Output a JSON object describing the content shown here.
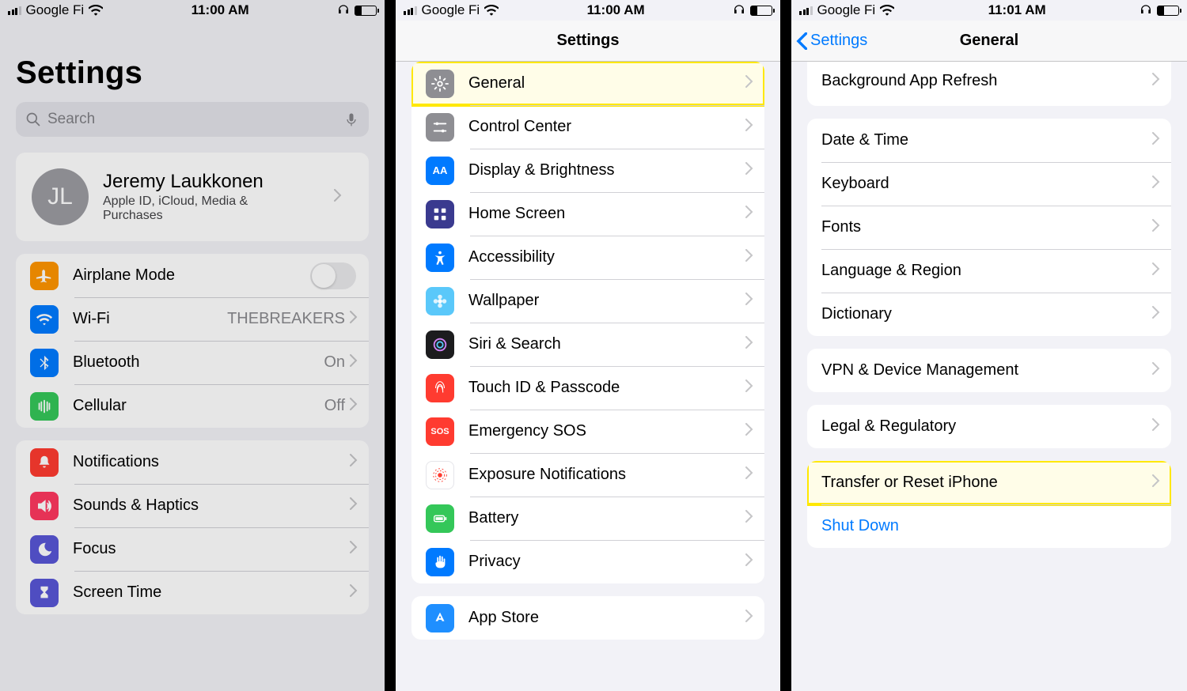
{
  "status": {
    "carrier": "Google Fi",
    "time1": "11:00 AM",
    "time2": "11:00 AM",
    "time3": "11:01 AM"
  },
  "phone1": {
    "title": "Settings",
    "search_placeholder": "Search",
    "profile": {
      "initials": "JL",
      "name": "Jeremy Laukkonen",
      "sub": "Apple ID, iCloud, Media & Purchases"
    },
    "airplane": "Airplane Mode",
    "wifi": "Wi-Fi",
    "wifi_value": "THEBREAKERS",
    "bluetooth": "Bluetooth",
    "bluetooth_value": "On",
    "cellular": "Cellular",
    "cellular_value": "Off",
    "notifications": "Notifications",
    "sounds": "Sounds & Haptics",
    "focus": "Focus",
    "screentime": "Screen Time"
  },
  "phone2": {
    "title": "Settings",
    "general": "General",
    "control_center": "Control Center",
    "display": "Display & Brightness",
    "homescreen": "Home Screen",
    "accessibility": "Accessibility",
    "wallpaper": "Wallpaper",
    "siri": "Siri & Search",
    "touchid": "Touch ID & Passcode",
    "emergency": "Emergency SOS",
    "exposure": "Exposure Notifications",
    "battery": "Battery",
    "privacy": "Privacy",
    "appstore": "App Store"
  },
  "phone3": {
    "back": "Settings",
    "title": "General",
    "background_refresh": "Background App Refresh",
    "datetime": "Date & Time",
    "keyboard": "Keyboard",
    "fonts": "Fonts",
    "language": "Language & Region",
    "dictionary": "Dictionary",
    "vpn": "VPN & Device Management",
    "legal": "Legal & Regulatory",
    "transfer": "Transfer or Reset iPhone",
    "shutdown": "Shut Down"
  }
}
